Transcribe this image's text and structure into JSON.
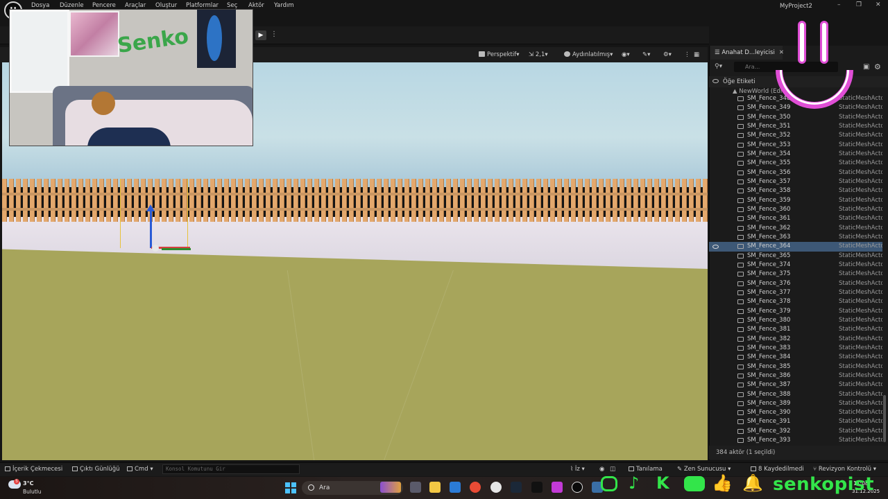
{
  "menubar": {
    "items": [
      "Dosya",
      "Düzenle",
      "Pencere",
      "Araçlar",
      "Oluştur",
      "Platformlar",
      "Seç",
      "Aktör",
      "Yardım"
    ],
    "project_title": "MyProject2",
    "win_controls": [
      "–",
      "❐",
      "✕"
    ]
  },
  "viewport": {
    "perspective_label": "Perspektif",
    "scale_label": "2,1",
    "lighting_label": "Aydınlatılmış",
    "axis_z": "z",
    "axis_y": "y"
  },
  "outliner": {
    "tab_label": "Anahat D...leyicisi",
    "search_placeholder": "Ara...",
    "header_label": "Öğe Etiketi",
    "world_label": "NewWorld (Edito",
    "type_label": "StaticMeshActo",
    "selected_index": 16,
    "rows": [
      "SM_Fence_348",
      "SM_Fence_349",
      "SM_Fence_350",
      "SM_Fence_351",
      "SM_Fence_352",
      "SM_Fence_353",
      "SM_Fence_354",
      "SM_Fence_355",
      "SM_Fence_356",
      "SM_Fence_357",
      "SM_Fence_358",
      "SM_Fence_359",
      "SM_Fence_360",
      "SM_Fence_361",
      "SM_Fence_362",
      "SM_Fence_363",
      "SM_Fence_364",
      "SM_Fence_365",
      "SM_Fence_374",
      "SM_Fence_375",
      "SM_Fence_376",
      "SM_Fence_377",
      "SM_Fence_378",
      "SM_Fence_379",
      "SM_Fence_380",
      "SM_Fence_381",
      "SM_Fence_382",
      "SM_Fence_383",
      "SM_Fence_384",
      "SM_Fence_385",
      "SM_Fence_386",
      "SM_Fence_387",
      "SM_Fence_388",
      "SM_Fence_389",
      "SM_Fence_390",
      "SM_Fence_391",
      "SM_Fence_392",
      "SM_Fence_393"
    ],
    "footer": "384 aktör (1 seçildi)"
  },
  "statusbar": {
    "content_drawer": "İçerik Çekmecesi",
    "output_log": "Çıktı Günlüğü",
    "cmd_label": "Cmd",
    "cmd_placeholder": "Konsol Komutunu Gir",
    "trace_label": "İz",
    "diagnostics": "Tanılama",
    "zen_server": "Zen Sunucusu",
    "unsaved": "8 Kaydedilmedi",
    "revision": "Revizyon Kontrolü"
  },
  "taskbar": {
    "temperature": "3°C",
    "weather": "Bulutlu",
    "weather_badge": "5",
    "search_label": "Ara",
    "time": "11:08",
    "date": "31.12.2025"
  },
  "overlay": {
    "webcam_text": "Senko",
    "social_name": "senkopist"
  },
  "colors": {
    "accent_pink": "#e04ed6",
    "social_green": "#33e54a",
    "selection": "#3d5876",
    "ground": "#a7a55b",
    "fence": "#e3a86d"
  }
}
